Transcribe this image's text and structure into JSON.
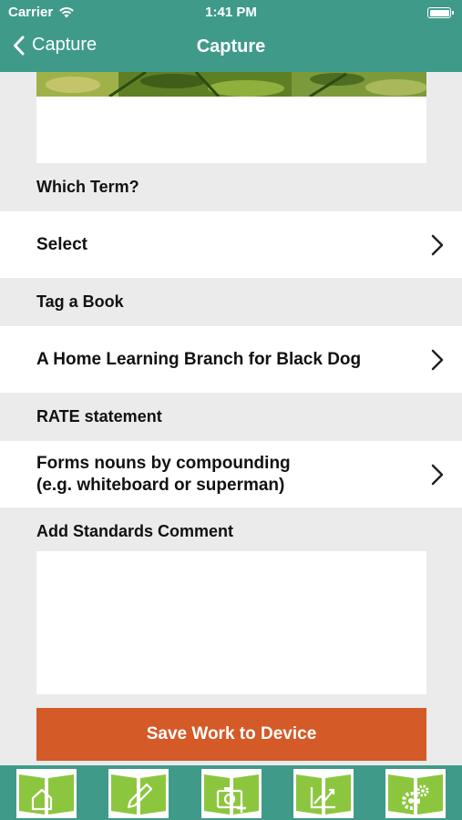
{
  "status_bar": {
    "carrier": "Carrier",
    "time": "1:41 PM"
  },
  "nav": {
    "back_label": "Capture",
    "title": "Capture"
  },
  "sections": {
    "term_label": "Which Term?",
    "term_value": "Select",
    "book_label": "Tag a Book",
    "book_value": "A Home Learning Branch for Black Dog",
    "rate_label": "RATE statement",
    "rate_value_line1": "Forms nouns by compounding",
    "rate_value_line2": "(e.g. whiteboard or superman)",
    "comment_label": "Add Standards Comment"
  },
  "comment": {
    "value": ""
  },
  "save_button": {
    "label": "Save Work to Device"
  },
  "tabs": [
    {
      "icon": "home-icon"
    },
    {
      "icon": "pencil-icon"
    },
    {
      "icon": "camera-add-icon"
    },
    {
      "icon": "chart-icon"
    },
    {
      "icon": "settings-gears-icon"
    }
  ],
  "colors": {
    "header": "#3f9a8a",
    "save_button": "#d45a28",
    "background": "#ebebeb",
    "tab_icon_green": "#8cc63f"
  }
}
